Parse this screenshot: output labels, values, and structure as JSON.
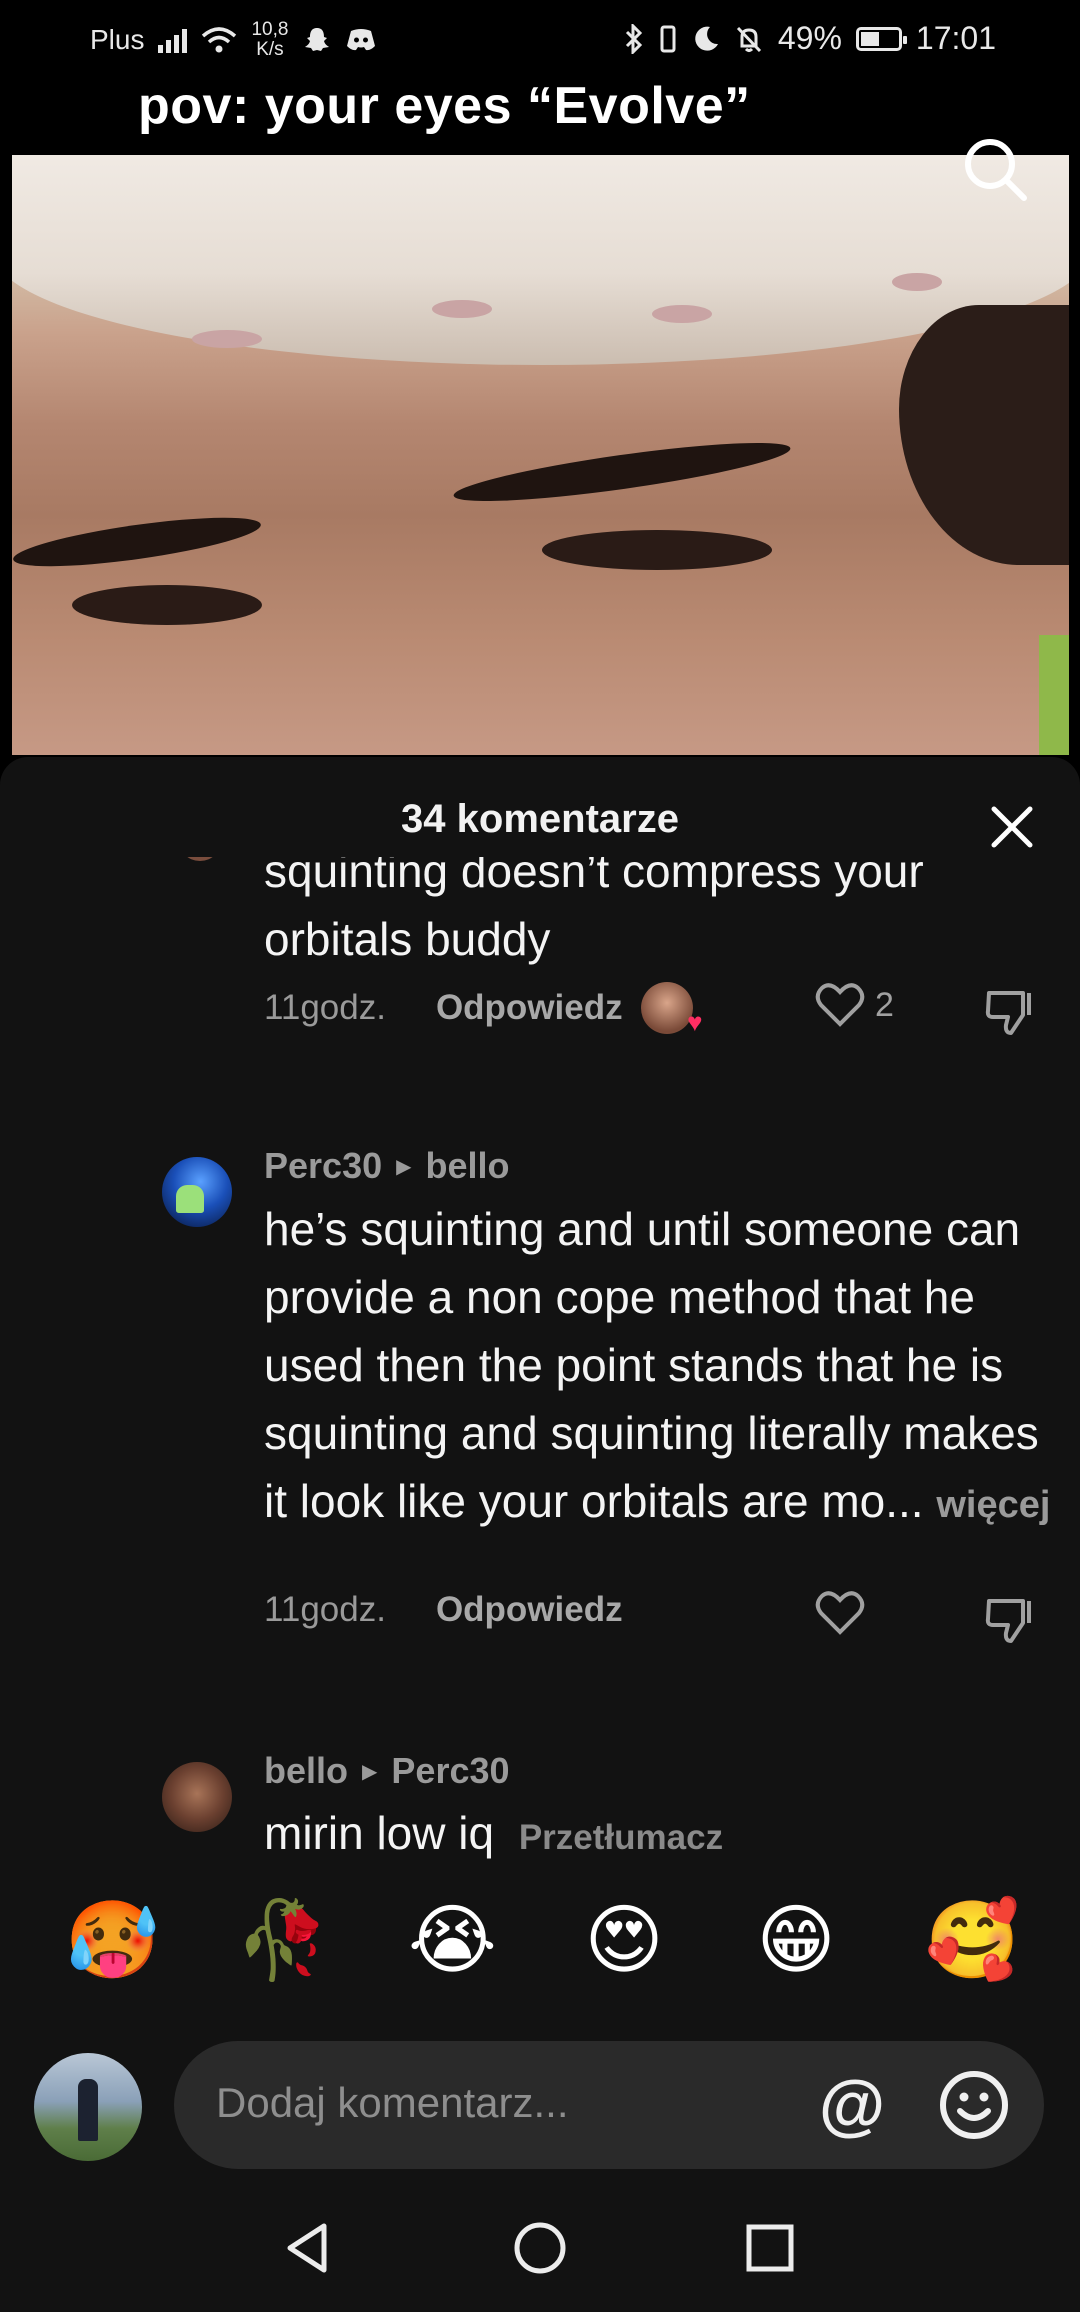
{
  "status_bar": {
    "carrier": "Plus",
    "speed_value": "10,8",
    "speed_unit": "K/s",
    "battery": "49%",
    "battery_level": 0.49,
    "time": "17:01"
  },
  "video": {
    "title": "pov: your eyes “Evolve”"
  },
  "comments_panel": {
    "title": "34 komentarze",
    "comments": [
      {
        "text": "squinting doesn’t compress your orbitals buddy",
        "time": "11godz.",
        "reply_label": "Odpowiedz",
        "likes": "2"
      },
      {
        "author": "Perc30",
        "reply_to": "bello",
        "text": "he’s squinting and until someone can provide a non cope method that he used then the point stands that he is squinting and squinting literally makes it look like your orbitals are mo...",
        "more_label": "więcej",
        "time": "11godz.",
        "reply_label": "Odpowiedz"
      },
      {
        "author": "bello",
        "reply_to": "Perc30",
        "text": "mirin low iq",
        "translate_label": "Przetłumacz"
      }
    ]
  },
  "emoji_bar": [
    "🥵",
    "🥀",
    "😭",
    "😍",
    "😁",
    "🥰"
  ],
  "comment_input": {
    "placeholder": "Dodaj komentarz..."
  },
  "colors": {
    "sheet_bg": "#121212",
    "input_bg": "#2a2a2a",
    "muted_text": "#9a9a9a"
  }
}
